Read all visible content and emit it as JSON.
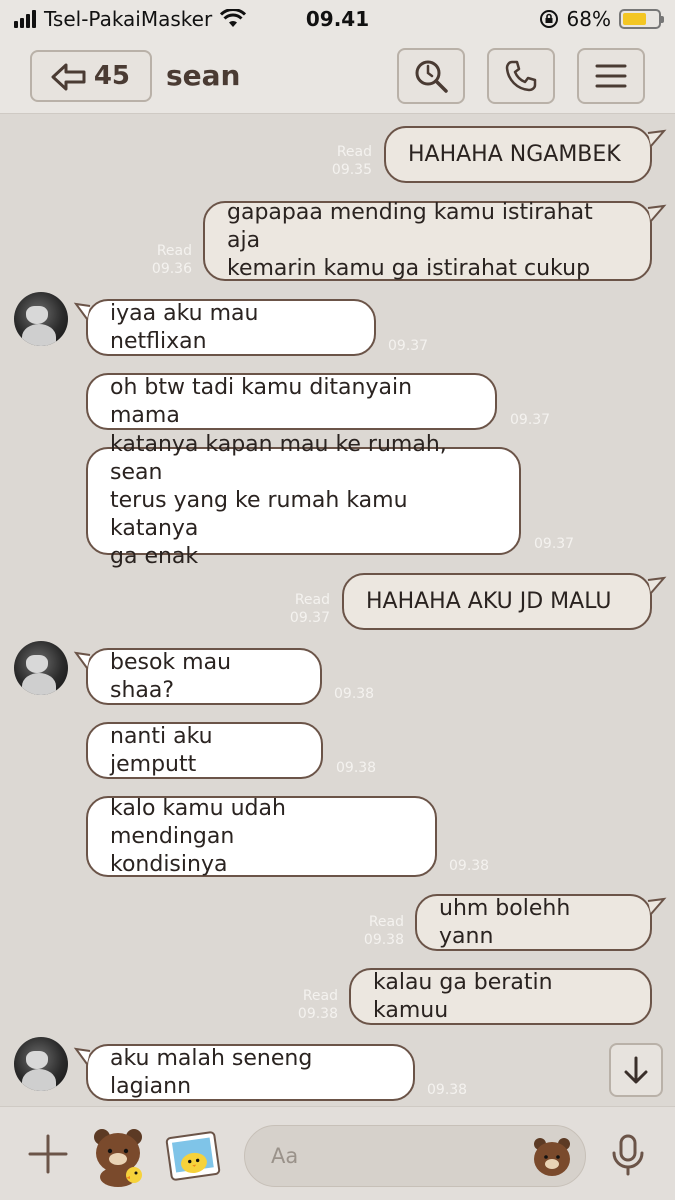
{
  "status_bar": {
    "carrier": "Tsel-PakaiMasker",
    "time": "09.41",
    "battery": "68%",
    "battery_level": 0.68
  },
  "header": {
    "back_count": "45",
    "title": "sean"
  },
  "messages": [
    {
      "side": "out",
      "text": "HAHAHA NGAMBEK",
      "read": "Read",
      "time": "09.35"
    },
    {
      "side": "out",
      "text": "gapapaa mending kamu istirahat aja\nkemarin kamu ga istirahat cukup",
      "read": "Read",
      "time": "09.36"
    },
    {
      "side": "in",
      "text": "iyaa aku mau netflixan",
      "time": "09.37"
    },
    {
      "side": "in",
      "text": "oh btw tadi kamu ditanyain mama",
      "time": "09.37"
    },
    {
      "side": "in",
      "text": "katanya kapan mau ke rumah, sean\nterus yang ke rumah kamu katanya\nga enak",
      "time": "09.37"
    },
    {
      "side": "out",
      "text": "HAHAHA AKU JD MALU",
      "read": "Read",
      "time": "09.37"
    },
    {
      "side": "in",
      "text": "besok mau shaa?",
      "time": "09.38"
    },
    {
      "side": "in",
      "text": "nanti aku jemputt",
      "time": "09.38"
    },
    {
      "side": "in",
      "text": "kalo kamu udah mendingan\nkondisinya",
      "time": "09.38"
    },
    {
      "side": "out",
      "text": "uhm bolehh yann",
      "read": "Read",
      "time": "09.38"
    },
    {
      "side": "out",
      "text": "kalau ga beratin kamuu",
      "read": "Read",
      "time": "09.38"
    },
    {
      "side": "in",
      "text": "aku malah seneng lagiann",
      "time": "09.38"
    }
  ],
  "input": {
    "placeholder": "Aa"
  },
  "icons": {
    "back": "back-arrow-icon",
    "search": "search-icon",
    "call": "phone-icon",
    "menu": "menu-icon",
    "scroll_down": "arrow-down-icon",
    "add": "plus-icon",
    "sticker": "sticker-icon",
    "photo": "photo-icon",
    "emoji": "emoji-icon",
    "mic": "microphone-icon"
  }
}
